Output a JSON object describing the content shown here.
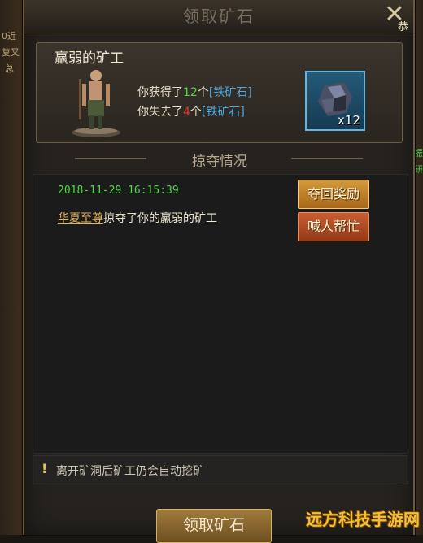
{
  "window": {
    "title": "领取矿石",
    "close_label": "恭"
  },
  "background_text": {
    "left_lines": [
      "0近",
      "复又",
      "总"
    ],
    "right_lines": [
      "已振",
      "手 研"
    ]
  },
  "reward": {
    "miner_name": "羸弱的矿工",
    "line1_prefix": "你获得了",
    "line1_count": "12",
    "line1_mid": "个",
    "line1_item": "[铁矿石]",
    "line2_prefix": "你失去了",
    "line2_count": "4",
    "line2_mid": "个",
    "line2_item": "[铁矿石]",
    "ore_count_label": "x12"
  },
  "section": {
    "title": "掠夺情况"
  },
  "log": {
    "time": "2018-11-29 16:15:39",
    "player": "华夏至尊",
    "action": "掠夺了你的",
    "miner": "羸弱的矿工",
    "reclaim_button": "夺回奖励",
    "help_button": "喊人帮忙"
  },
  "notice": {
    "icon": "!",
    "text": "离开矿洞后矿工仍会自动挖矿"
  },
  "footer": {
    "collect_button": "领取矿石"
  },
  "watermark": "远方科技手游网",
  "colors": {
    "gain": "#53d640",
    "loss": "#e23a2f",
    "item": "#4fa8e0",
    "timestamp": "#54d84a"
  }
}
